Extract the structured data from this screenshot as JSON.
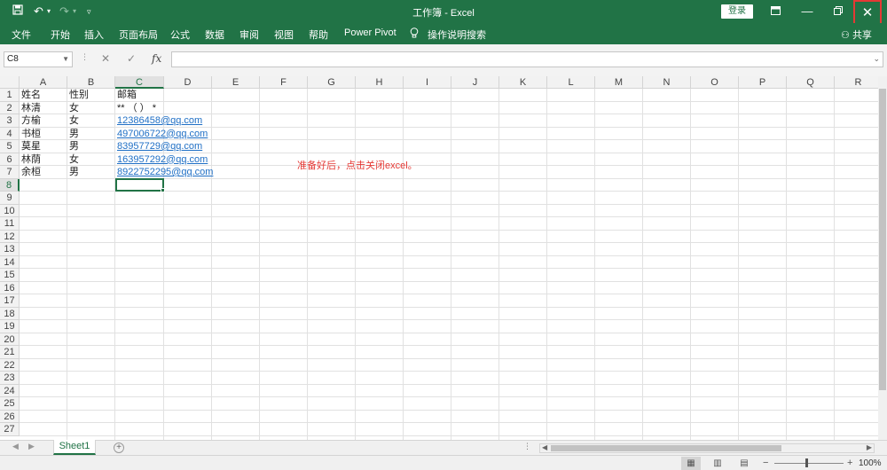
{
  "window": {
    "title": "工作簿 - Excel",
    "login_label": "登录",
    "icons": [
      "save-icon",
      "undo-icon",
      "redo-icon",
      "customize-icon",
      "ribbon-display-icon",
      "minimize-icon",
      "restore-icon",
      "close-icon"
    ],
    "close_glyph": "✕"
  },
  "ribbon": {
    "tabs": [
      "文件",
      "开始",
      "插入",
      "页面布局",
      "公式",
      "数据",
      "审阅",
      "视图",
      "帮助",
      "Power Pivot"
    ],
    "tell_me": "操作说明搜索",
    "share": "共享"
  },
  "formula_bar": {
    "name_box": "C8",
    "formula": ""
  },
  "columns": [
    "A",
    "B",
    "C",
    "D",
    "E",
    "F",
    "G",
    "H",
    "I",
    "J",
    "K",
    "L",
    "M",
    "N",
    "O",
    "P",
    "Q",
    "R"
  ],
  "selected_column": "C",
  "rows": [
    "1",
    "2",
    "3",
    "4",
    "5",
    "6",
    "7",
    "8",
    "9",
    "10",
    "11",
    "12",
    "13",
    "14",
    "15",
    "16",
    "17",
    "18",
    "19",
    "20",
    "21",
    "22",
    "23",
    "24",
    "25",
    "26",
    "27"
  ],
  "selected_row": "8",
  "cells": {
    "r1": [
      "姓名",
      "性别",
      "邮箱"
    ],
    "r2": [
      "林清",
      "女",
      "** （ ） *"
    ],
    "r3": [
      "方榆",
      "女",
      "12386458@qq.com"
    ],
    "r4": [
      "书桓",
      "男",
      "497006722@qq.com"
    ],
    "r5": [
      "莫星",
      "男",
      "83957729@qq.com"
    ],
    "r6": [
      "林荫",
      "女",
      "163957292@qq.com"
    ],
    "r7": [
      "余桓",
      "男",
      "8922752295@qq.com"
    ]
  },
  "annotation": "准备好后，点击关闭excel。",
  "sheets": [
    "Sheet1"
  ],
  "status": {
    "zoom": "100%"
  },
  "colors": {
    "accent": "#217346",
    "annotation": "#e53935",
    "link": "#1f6fc5"
  }
}
